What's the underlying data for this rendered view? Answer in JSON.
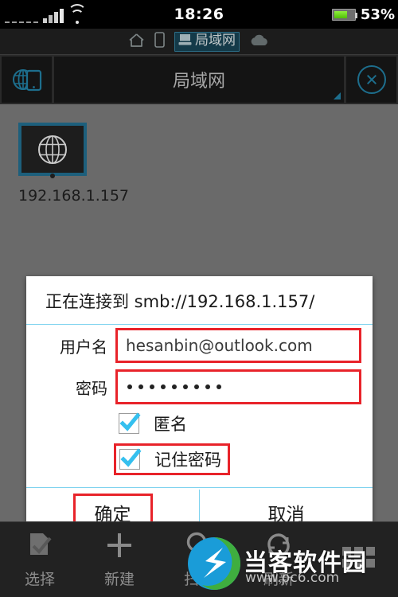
{
  "status_bar": {
    "clock": "18:26",
    "battery_percent": "53%",
    "battery_level": 53,
    "icons": [
      "signal-dashes-icon",
      "signal-bars-icon",
      "wifi-icon",
      "battery-icon"
    ]
  },
  "breadcrumb": {
    "items": [
      {
        "icon": "home-icon",
        "label": ""
      },
      {
        "icon": "device-phone-icon",
        "label": ""
      },
      {
        "icon": "computer-icon",
        "label": "局域网",
        "active": true
      },
      {
        "icon": "cloud-icon",
        "label": ""
      }
    ],
    "active_label": "局域网"
  },
  "toolbar": {
    "left_icon": "globe-device-icon",
    "title": "局域网",
    "close_icon": "close-circle-icon",
    "corner_icon": "resize-corner-icon",
    "accent_color": "#1d6e8d"
  },
  "content": {
    "host_icon": "computer-monitor-globe-icon",
    "host_label": "192.168.1.157"
  },
  "dialog": {
    "title": "正在连接到 smb://192.168.1.157/",
    "fields": [
      {
        "label": "用户名",
        "value": "hesanbin@outlook.com",
        "type": "text",
        "highlight": true
      },
      {
        "label": "密码",
        "value": "•••••••••",
        "masked_count": 9,
        "type": "password",
        "highlight": true
      }
    ],
    "checkboxes": [
      {
        "label": "匿名",
        "checked": true,
        "highlight": false
      },
      {
        "label": "记住密码",
        "checked": true,
        "highlight": true
      }
    ],
    "buttons": [
      {
        "label": "确定",
        "highlight": true
      },
      {
        "label": "取消",
        "highlight": false
      }
    ],
    "highlight_color": "#e8232a",
    "rule_color": "#7fd3ef"
  },
  "bottom_bar": {
    "items": [
      {
        "icon": "select-document-icon",
        "label": "选择"
      },
      {
        "icon": "plus-icon",
        "label": "新建"
      },
      {
        "icon": "search-icon",
        "label": "扫描"
      },
      {
        "icon": "refresh-icon",
        "label": "刷新"
      },
      {
        "icon": "grid-apps-icon",
        "label": ""
      }
    ]
  },
  "watermark": {
    "text": "当客软件园",
    "url": "www.pc6.com"
  }
}
